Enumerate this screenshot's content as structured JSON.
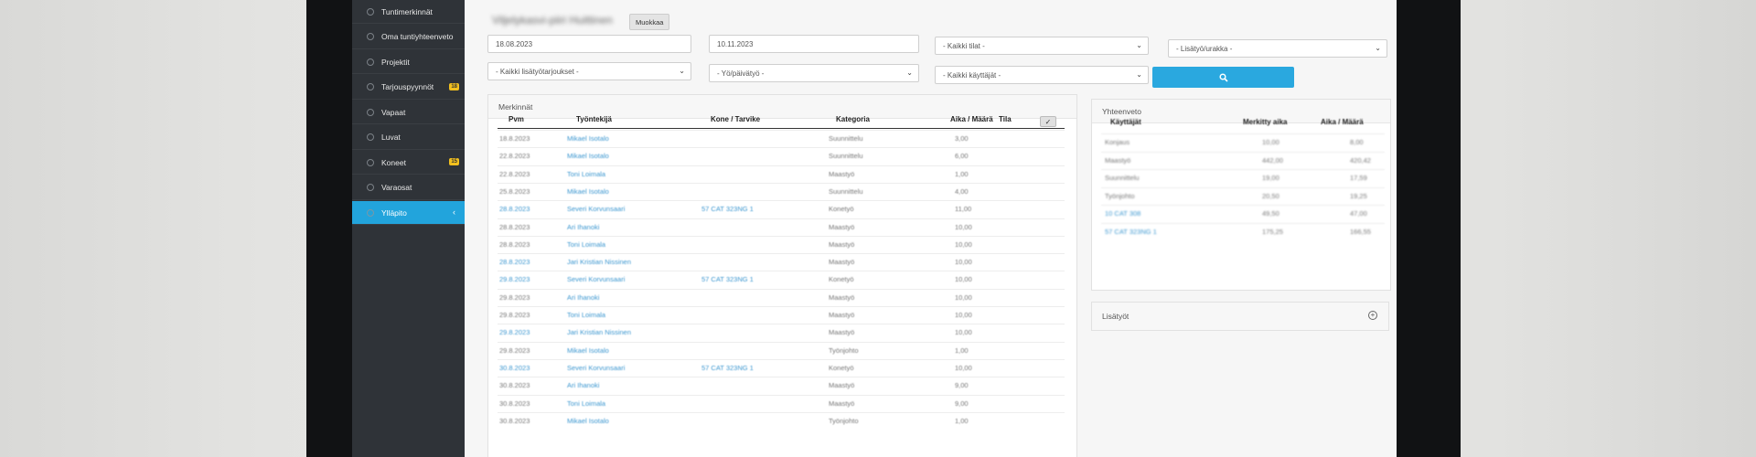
{
  "sidebar": {
    "items": [
      {
        "label": "Tuntimerkinnät",
        "icon": "clock-icon"
      },
      {
        "label": "Oma tuntiyhteenveto",
        "icon": "clock-icon"
      },
      {
        "label": "Projektit",
        "icon": "rocket-icon"
      },
      {
        "label": "Tarjouspyynnöt",
        "icon": "rocket-icon",
        "badge": "18"
      },
      {
        "label": "Vapaat",
        "icon": "calendar-icon"
      },
      {
        "label": "Luvat",
        "icon": "lock-icon"
      },
      {
        "label": "Koneet",
        "icon": "wrench-icon",
        "badge": "15"
      },
      {
        "label": "Varaosat",
        "icon": "gear-icon"
      },
      {
        "label": "Ylläpito",
        "icon": "key-icon",
        "active": true
      }
    ]
  },
  "header": {
    "title": "Viljelykasvi-piiri Huittinen",
    "edit_label": "Muokkaa"
  },
  "filters": {
    "date_from": "18.08.2023",
    "date_to": "10.11.2023",
    "status": "- Kaikki tilat -",
    "extra_work": "- Lisätyö/urakka -",
    "extra_offers": "- Kaikki lisätyötarjoukset -",
    "day_night": "- Yö/päivätyö -",
    "users": "- Kaikki käyttäjät -"
  },
  "entries": {
    "panel_title": "Merkinnät",
    "columns": [
      "Pvm",
      "Työntekijä",
      "Kone / Tarvike",
      "Kategoria",
      "Aika / Määrä",
      "Tila"
    ],
    "rows": [
      {
        "date": "18.8.2023",
        "worker": "Mikael Isotalo",
        "machine": "",
        "category": "Suunnittelu",
        "amount": "3,00"
      },
      {
        "date": "22.8.2023",
        "worker": "Mikael Isotalo",
        "machine": "",
        "category": "Suunnittelu",
        "amount": "6,00"
      },
      {
        "date": "22.8.2023",
        "worker": "Toni Loimala",
        "machine": "",
        "category": "Maastyö",
        "amount": "1,00"
      },
      {
        "date": "25.8.2023",
        "worker": "Mikael Isotalo",
        "machine": "",
        "category": "Suunnittelu",
        "amount": "4,00"
      },
      {
        "date": "28.8.2023",
        "worker": "Severi Korvunsaari",
        "machine": "57 CAT 323NG 1",
        "category": "Konetyö",
        "amount": "11,00"
      },
      {
        "date": "28.8.2023",
        "worker": "Ari Ihanoki",
        "machine": "",
        "category": "Maastyö",
        "amount": "10,00"
      },
      {
        "date": "28.8.2023",
        "worker": "Toni Loimala",
        "machine": "",
        "category": "Maastyö",
        "amount": "10,00"
      },
      {
        "date": "28.8.2023",
        "worker": "Jari Kristian Nissinen",
        "machine": "",
        "category": "Maastyö",
        "amount": "10,00"
      },
      {
        "date": "29.8.2023",
        "worker": "Severi Korvunsaari",
        "machine": "57 CAT 323NG 1",
        "category": "Konetyö",
        "amount": "10,00"
      },
      {
        "date": "29.8.2023",
        "worker": "Ari Ihanoki",
        "machine": "",
        "category": "Maastyö",
        "amount": "10,00"
      },
      {
        "date": "29.8.2023",
        "worker": "Toni Loimala",
        "machine": "",
        "category": "Maastyö",
        "amount": "10,00"
      },
      {
        "date": "29.8.2023",
        "worker": "Jari Kristian Nissinen",
        "machine": "",
        "category": "Maastyö",
        "amount": "10,00"
      },
      {
        "date": "29.8.2023",
        "worker": "Mikael Isotalo",
        "machine": "",
        "category": "Työnjohto",
        "amount": "1,00"
      },
      {
        "date": "30.8.2023",
        "worker": "Severi Korvunsaari",
        "machine": "57 CAT 323NG 1",
        "category": "Konetyö",
        "amount": "10,00"
      },
      {
        "date": "30.8.2023",
        "worker": "Ari Ihanoki",
        "machine": "",
        "category": "Maastyö",
        "amount": "9,00"
      },
      {
        "date": "30.8.2023",
        "worker": "Toni Loimala",
        "machine": "",
        "category": "Maastyö",
        "amount": "9,00"
      },
      {
        "date": "30.8.2023",
        "worker": "Mikael Isotalo",
        "machine": "",
        "category": "Työnjohto",
        "amount": "1,00"
      }
    ]
  },
  "summary": {
    "panel_title": "Yhteenveto",
    "columns": [
      "Käyttäjät",
      "Merkitty aika",
      "Aika / Määrä"
    ],
    "rows": [
      {
        "name": "Konjaus",
        "marked": "10,00",
        "amount": "8,00",
        "link": false
      },
      {
        "name": "Maastyö",
        "marked": "442,00",
        "amount": "420,42",
        "link": false
      },
      {
        "name": "Suunnittelu",
        "marked": "19,00",
        "amount": "17,59",
        "link": false
      },
      {
        "name": "Työnjohto",
        "marked": "20,50",
        "amount": "19,25",
        "link": false
      },
      {
        "name": "10 CAT 308",
        "marked": "49,50",
        "amount": "47,00",
        "link": true
      },
      {
        "name": "57 CAT 323NG 1",
        "marked": "175,25",
        "amount": "166,55",
        "link": true
      }
    ]
  },
  "extras": {
    "panel_title": "Lisätyöt"
  },
  "colors": {
    "accent": "#2aa8df",
    "sidebar_bg": "#2f3338",
    "badge": "#f2c01e",
    "link": "#3c97d0"
  }
}
